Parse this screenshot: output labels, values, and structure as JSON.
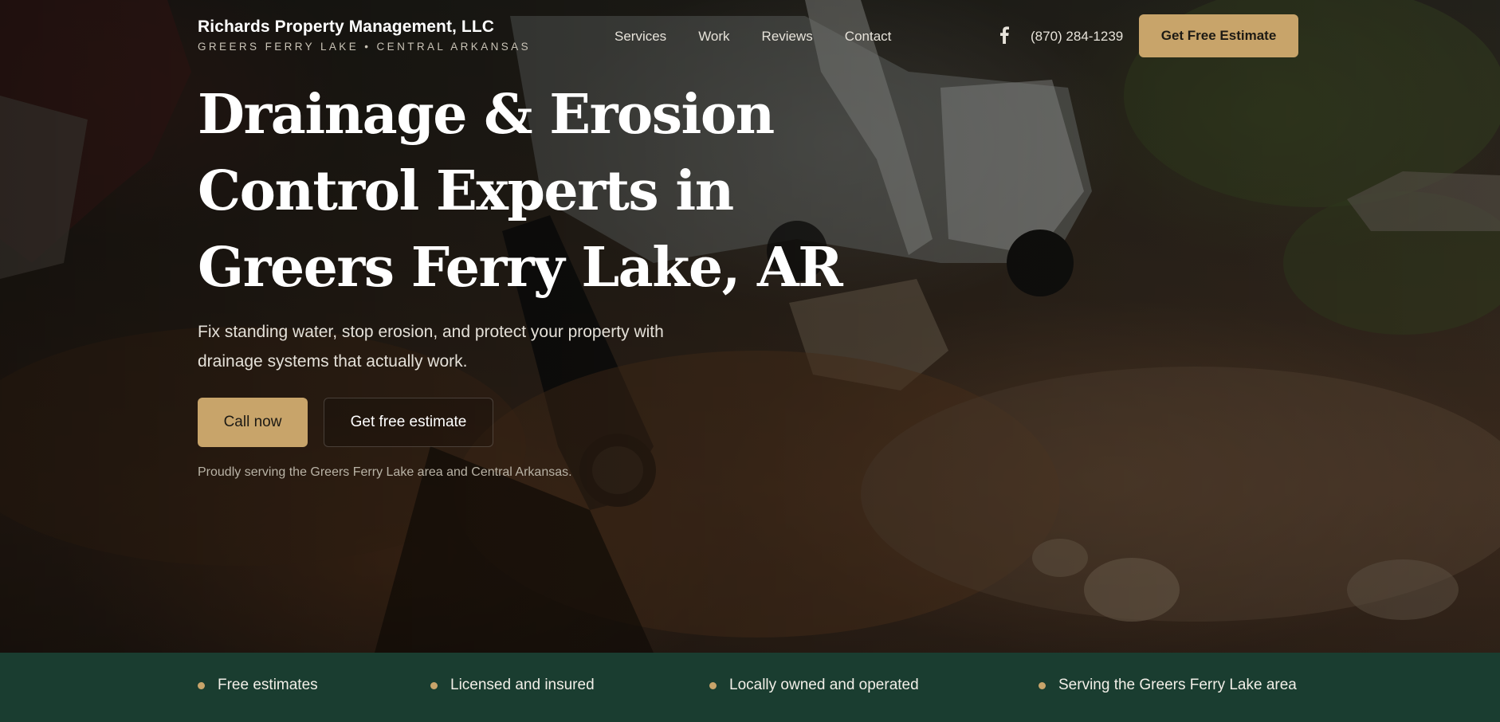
{
  "brand": {
    "name": "Richards Property Management, LLC",
    "tagline": "GREERS FERRY LAKE • CENTRAL ARKANSAS"
  },
  "nav": {
    "items": [
      "Services",
      "Work",
      "Reviews",
      "Contact"
    ]
  },
  "header": {
    "facebook_icon": "facebook-icon",
    "phone": "(870) 284-1239",
    "cta_label": "Get Free Estimate"
  },
  "hero": {
    "headline_lines": [
      "Drainage & Erosion",
      "Control Experts in",
      "Greers Ferry Lake, AR"
    ],
    "subhead_lines": [
      "Fix standing water, stop erosion, and protect your property with",
      "drainage systems that actually work."
    ],
    "primary_cta": "Call now",
    "secondary_cta": "Get free estimate",
    "service_note": "Proudly serving the Greers Ferry Lake area and Central Arkansas."
  },
  "trust_bar": {
    "items": [
      "Free estimates",
      "Licensed and insured",
      "Locally owned and operated",
      "Serving the Greers Ferry Lake area"
    ]
  },
  "colors": {
    "accent_gold": "#c8a46a",
    "forest_green": "#1a3d30"
  }
}
